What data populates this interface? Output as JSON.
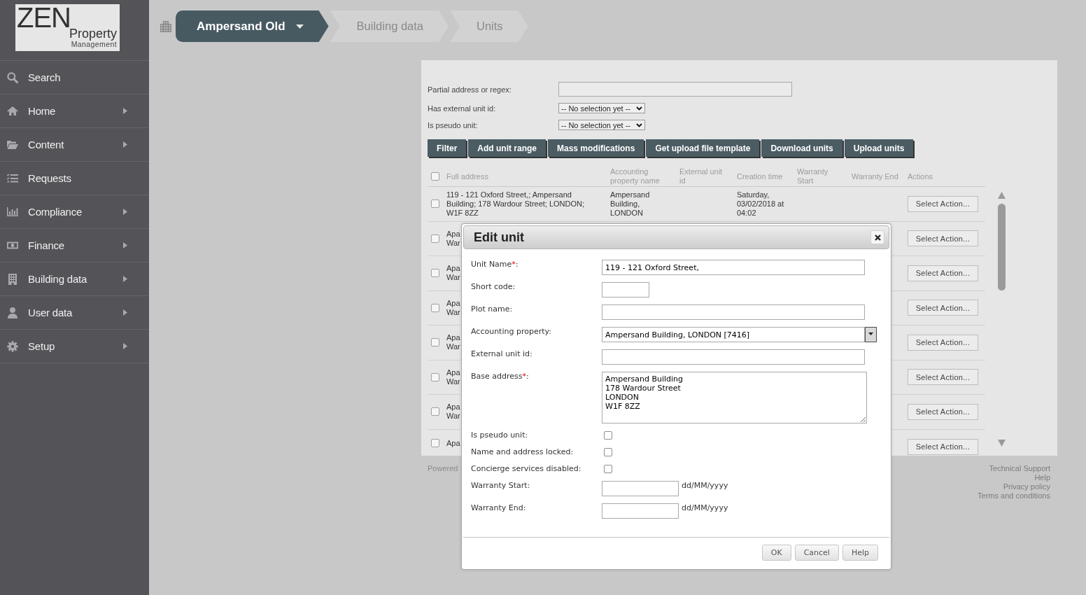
{
  "logo": {
    "wordmark": "ZEN",
    "line_2": "Property",
    "line_3": "Management"
  },
  "sidebar": {
    "items": [
      {
        "label": "Search",
        "submenu": false
      },
      {
        "label": "Home",
        "submenu": true
      },
      {
        "label": "Content",
        "submenu": true
      },
      {
        "label": "Requests",
        "submenu": false
      },
      {
        "label": "Compliance",
        "submenu": true
      },
      {
        "label": "Finance",
        "submenu": true
      },
      {
        "label": "Building data",
        "submenu": true
      },
      {
        "label": "User data",
        "submenu": true
      },
      {
        "label": "Setup",
        "submenu": true
      }
    ]
  },
  "breadcrumb": {
    "items": [
      {
        "label": "Ampersand Old",
        "kind": "context"
      },
      {
        "label": "Building data",
        "kind": "crumb"
      },
      {
        "label": "Units",
        "kind": "crumb"
      }
    ]
  },
  "filters": [
    {
      "label": "Partial address or regex:",
      "kind": "text"
    },
    {
      "label": "Has external unit id:",
      "kind": "select",
      "value": "-- No selection yet --"
    },
    {
      "label": "Is pseudo unit:",
      "kind": "select",
      "value": "-- No selection yet --"
    }
  ],
  "toolbar": {
    "buttons": [
      "Filter",
      "Add unit range",
      "Mass modifications",
      "Get upload file template",
      "Download units",
      "Upload units"
    ]
  },
  "table": {
    "select_all": {
      "checked": false
    },
    "columns": [
      "Full address",
      "Accounting property name",
      "External unit id",
      "Creation time",
      "Warranty Start",
      "Warranty End",
      "Actions"
    ],
    "rows": [
      {
        "checked": false,
        "full_address": "119 - 121 Oxford Street,; Ampersand Building; 178 Wardour Street; LONDON; W1F 8ZZ",
        "accounting_property_name": "Ampersand Building, LONDON",
        "creation_time": "Saturday, 03/02/2018 at 04:02",
        "action": "Select Action..."
      },
      {
        "checked": false,
        "full_address": "Apa\nWar",
        "action": "Select Action..."
      },
      {
        "checked": false,
        "full_address": "Apa\nWar",
        "action": "Select Action..."
      },
      {
        "checked": false,
        "full_address": "Apa\nWar",
        "action": "Select Action..."
      },
      {
        "checked": false,
        "full_address": "Apa\nWar",
        "action": "Select Action..."
      },
      {
        "checked": false,
        "full_address": "Apa\nWar",
        "action": "Select Action..."
      },
      {
        "checked": false,
        "full_address": "Apa\nWar",
        "action": "Select Action..."
      },
      {
        "checked": false,
        "full_address": "Apa",
        "action": "Select Action..."
      }
    ]
  },
  "footer": {
    "left_text": "Powered",
    "links": [
      "Technical Support",
      "Help",
      "Privacy policy",
      "Terms and conditions"
    ]
  },
  "dialog": {
    "title": "Edit unit",
    "fields": [
      {
        "kind": "text",
        "label": "Unit Name",
        "required_mark": "*",
        "label_end": ":",
        "value": "119 - 121 Oxford Street,"
      },
      {
        "kind": "short_text",
        "label": "Short code:"
      },
      {
        "kind": "text",
        "label": "Plot name:"
      },
      {
        "kind": "select",
        "label": "Accounting property:",
        "value": "Ampersand Building, LONDON [7416]"
      },
      {
        "kind": "text",
        "label": "External unit id:"
      },
      {
        "kind": "textarea",
        "label": "Base address",
        "required_mark": "*",
        "label_end": ":",
        "value": "Ampersand Building\n178 Wardour Street\nLONDON\nW1F 8ZZ"
      },
      {
        "kind": "checkbox",
        "label": "Is pseudo unit:",
        "checked": false
      },
      {
        "kind": "checkbox",
        "label": "Name and address locked:",
        "checked": false
      },
      {
        "kind": "checkbox",
        "label": "Concierge services disabled:",
        "checked": false
      },
      {
        "kind": "date",
        "label": "Warranty Start:",
        "hint": "dd/MM/yyyy"
      },
      {
        "kind": "date",
        "label": "Warranty End:",
        "hint": "dd/MM/yyyy"
      }
    ],
    "buttons": [
      "OK",
      "Cancel",
      "Help"
    ]
  }
}
